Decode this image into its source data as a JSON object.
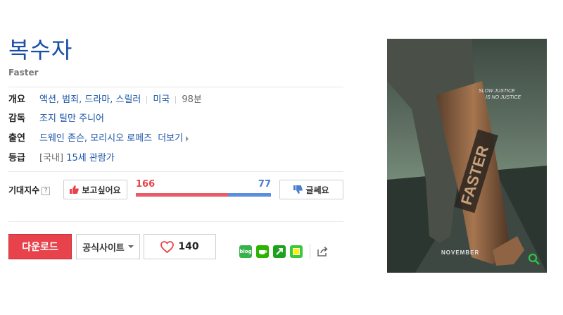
{
  "movie": {
    "title_ko": "복수자",
    "title_en": "Faster"
  },
  "details": {
    "overview_label": "개요",
    "genres": "액션, 범죄, 드라마, 스릴러",
    "country": "미국",
    "runtime": "98분",
    "director_label": "감독",
    "director": "조지 틸만 주니어",
    "cast_label": "출연",
    "cast": "드웨인 존슨, 모리시오 로페즈",
    "more_label": "더보기",
    "rating_label": "등급",
    "rating_region": "[국내]",
    "rating_value": "15세 관람가"
  },
  "expectation": {
    "label": "기대지수",
    "help": "?",
    "want_label": "보고싶어요",
    "meh_label": "글쎄요",
    "likes": 166,
    "dislikes": 77,
    "like_color": "#e85c67",
    "dislike_color": "#5b8fde"
  },
  "actions": {
    "download_label": "다운로드",
    "official_site_label": "공식사이트",
    "like_count": "140"
  },
  "share_icons": [
    {
      "name": "blog-share-icon",
      "color": "#36b24a"
    },
    {
      "name": "cafe-share-icon",
      "color": "#2db400"
    },
    {
      "name": "bookmark-share-icon",
      "color": "#1ea21e"
    },
    {
      "name": "memo-share-icon",
      "color": "#3cc83c"
    }
  ],
  "poster": {
    "tagline_1": "SLOW JUSTICE",
    "tagline_2": "IS NO JUSTICE",
    "tattoo": "FASTER",
    "release": "NOVEMBER"
  }
}
